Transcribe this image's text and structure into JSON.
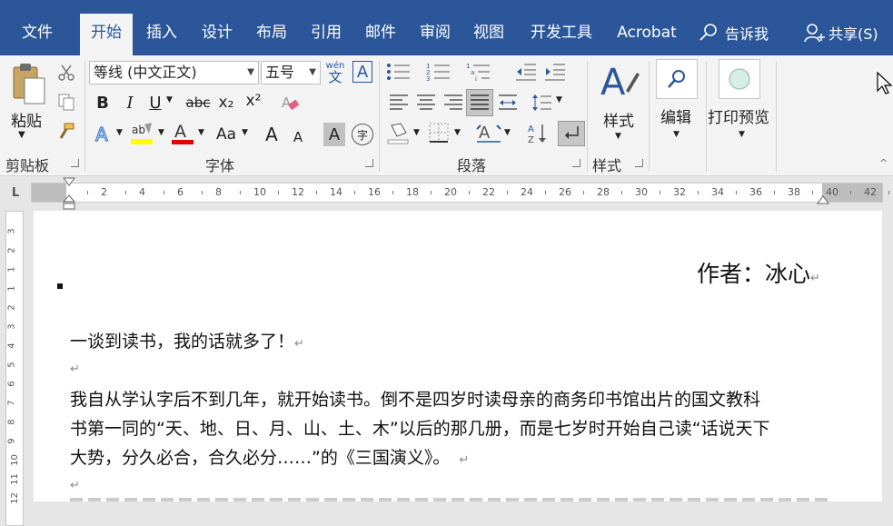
{
  "tabs": [
    "文件",
    "开始",
    "插入",
    "设计",
    "布局",
    "引用",
    "邮件",
    "审阅",
    "视图",
    "开发工具",
    "Acrobat"
  ],
  "active_tab": "开始",
  "tell_me": "告诉我",
  "share": "共享(S)",
  "clipboard": {
    "paste_label": "粘贴",
    "group_label": "剪贴板"
  },
  "font": {
    "font_name": "等线 (中文正文)",
    "font_size": "五号",
    "group_label": "字体",
    "bold": "B",
    "italic": "I",
    "underline": "U",
    "strike": "abc",
    "subscript": "x₂",
    "superscript": "x²",
    "phonetic": "wén",
    "phonetic_char": "文",
    "border_char": "A",
    "grow": "A",
    "shrink": "A",
    "case": "Aa",
    "enclose": "字",
    "highlight_color": "#ffff00",
    "font_color": "#e00000"
  },
  "paragraph": {
    "group_label": "段落"
  },
  "styles": {
    "label": "样式",
    "group_label": "样式"
  },
  "editing": {
    "label": "编辑"
  },
  "print_preview": {
    "label": "打印预览"
  },
  "ruler_labels": [
    "2",
    "4",
    "6",
    "8",
    "10",
    "12",
    "14",
    "16",
    "18",
    "20",
    "22",
    "24",
    "26",
    "28",
    "30",
    "32",
    "34",
    "36",
    "38",
    "40",
    "42"
  ],
  "vruler_labels": [
    "3",
    "2",
    "1",
    "1",
    "2",
    "3",
    "4",
    "5",
    "6",
    "7",
    "8",
    "9",
    "10",
    "11",
    "12"
  ],
  "document": {
    "author_line": "作者：冰心",
    "line1": "一谈到读书，我的话就多了！",
    "para1_l1": "我自从学认字后不到几年，就开始读书。倒不是四岁时读母亲的商务印书馆出片的国文教科",
    "para1_l2": "书第一同的“天、地、日、月、山、土、木”以后的那几册，而是七岁时开始自己读“话说天下",
    "para1_l3": "大势，分久必合，合久必分……”的《三国演义》。",
    "para_mark": "↵"
  },
  "colors": {
    "accent": "#2b579a",
    "ribbon": "#f3f3f3",
    "page": "#ffffff",
    "ruler_grey": "#bdbdbd"
  }
}
